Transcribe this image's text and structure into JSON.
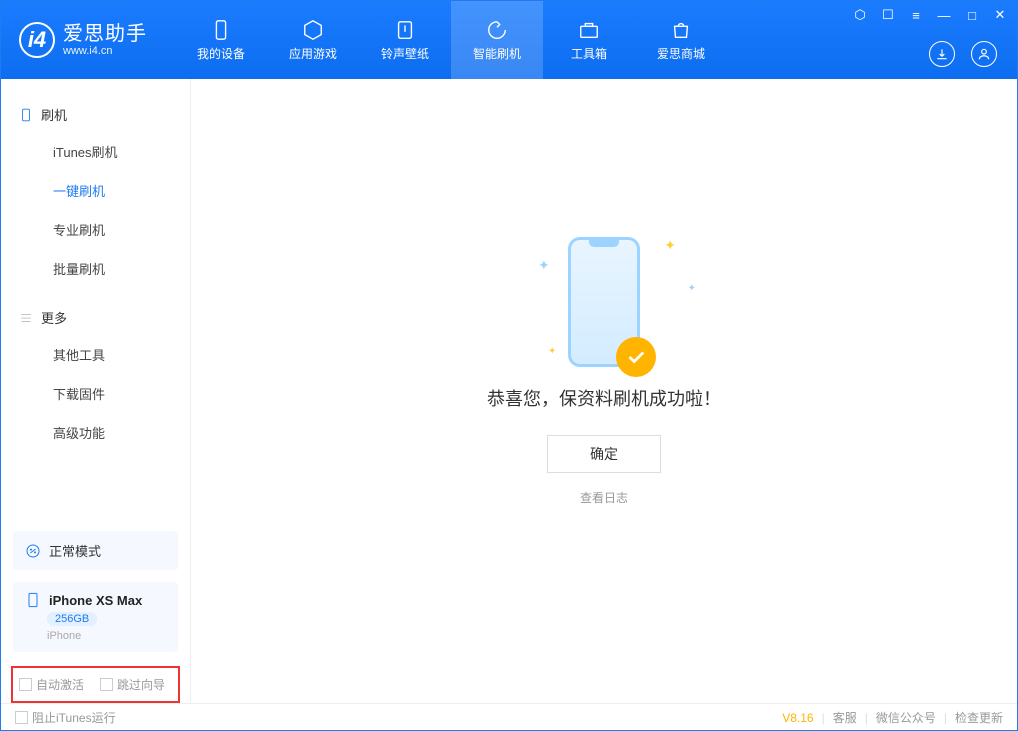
{
  "app": {
    "title": "爱思助手",
    "url": "www.i4.cn"
  },
  "nav": [
    {
      "label": "我的设备",
      "icon": "phone"
    },
    {
      "label": "应用游戏",
      "icon": "cube"
    },
    {
      "label": "铃声壁纸",
      "icon": "music"
    },
    {
      "label": "智能刷机",
      "icon": "refresh"
    },
    {
      "label": "工具箱",
      "icon": "toolbox"
    },
    {
      "label": "爱思商城",
      "icon": "bag"
    }
  ],
  "sidebar": {
    "group1": {
      "header": "刷机",
      "items": [
        "iTunes刷机",
        "一键刷机",
        "专业刷机",
        "批量刷机"
      ]
    },
    "group2": {
      "header": "更多",
      "items": [
        "其他工具",
        "下载固件",
        "高级功能"
      ]
    }
  },
  "mode": {
    "label": "正常模式"
  },
  "device": {
    "name": "iPhone XS Max",
    "capacity": "256GB",
    "type": "iPhone"
  },
  "options": {
    "autoActivate": "自动激活",
    "skipGuide": "跳过向导"
  },
  "main": {
    "success": "恭喜您，保资料刷机成功啦！",
    "ok": "确定",
    "viewLog": "查看日志"
  },
  "footer": {
    "blockItunes": "阻止iTunes运行",
    "version": "V8.16",
    "cs": "客服",
    "wechat": "微信公众号",
    "update": "检查更新"
  }
}
